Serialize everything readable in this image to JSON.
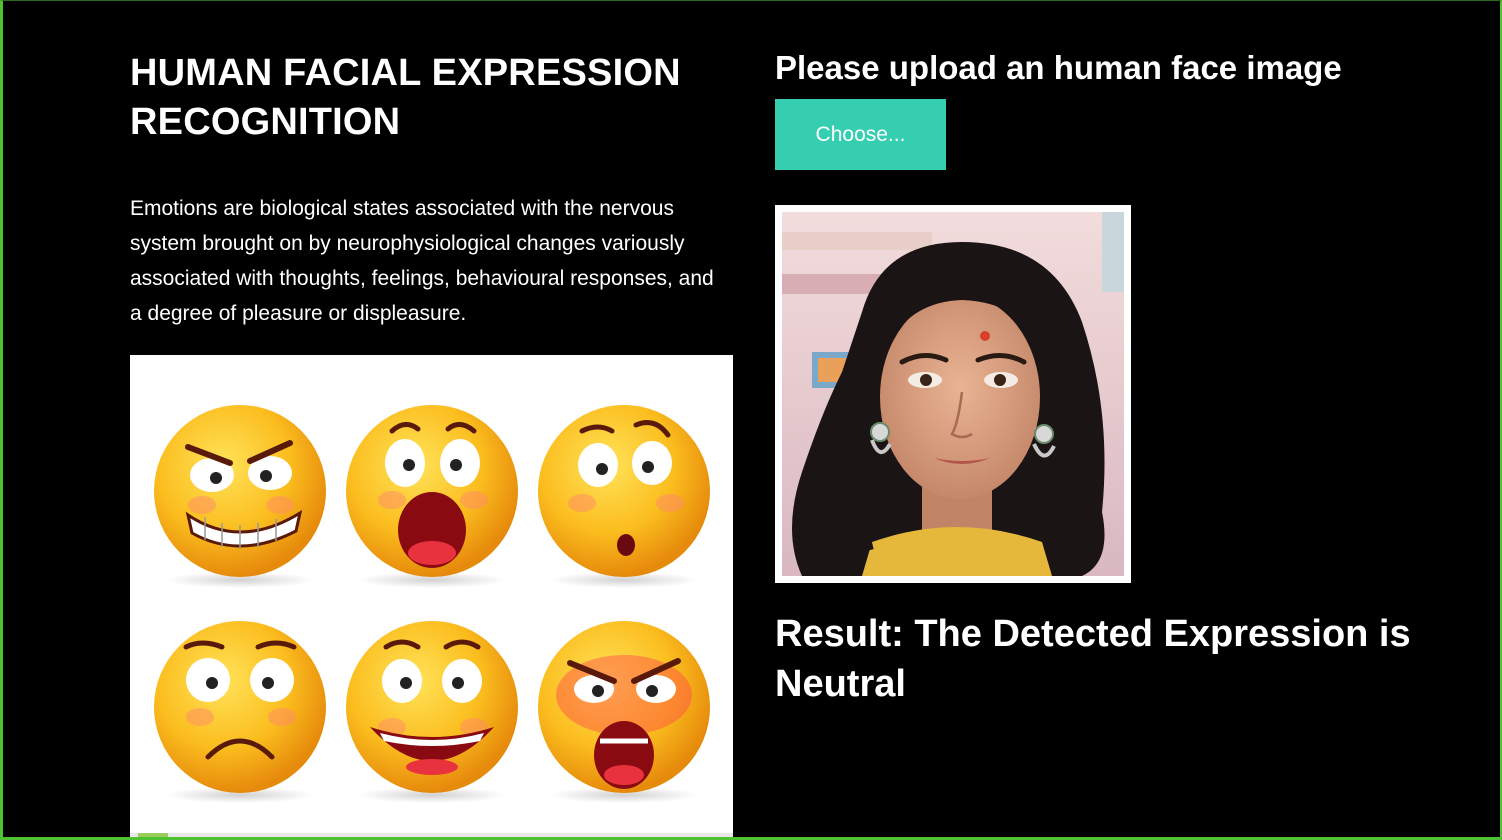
{
  "page": {
    "title": "HUMAN FACIAL EXPRESSION RECOGNITION",
    "description": "Emotions are biological states associated with the nervous system brought on by neurophysiological changes variously associated with thoughts, feelings, behavioural responses, and a degree of pleasure or displeasure."
  },
  "upload": {
    "heading": "Please upload an human face image",
    "choose_label": "Choose..."
  },
  "result": {
    "text": "Result: The Detected Expression is Neutral"
  },
  "images": {
    "emoji_panel": "emotion-emoji-collage",
    "uploaded_photo": "uploaded-face-photo"
  },
  "colors": {
    "background": "#000000",
    "accent_button": "#35ceb0",
    "frame_border": "#4fc234",
    "emoji_yellow": "#f9b81c"
  }
}
